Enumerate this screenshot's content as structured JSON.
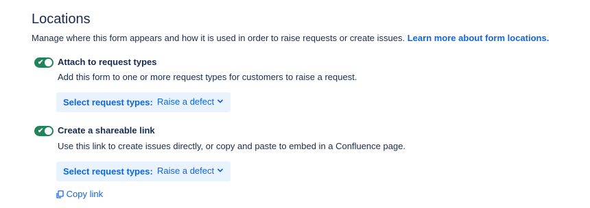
{
  "section": {
    "title": "Locations",
    "description": "Manage where this form appears and how it is used in order to raise requests or create issues.",
    "learn_more_link": "Learn more about form locations."
  },
  "options": [
    {
      "label": "Attach to request types",
      "enabled": true,
      "description": "Add this form to one or more request types for customers to raise a request.",
      "select_label": "Select request types:",
      "select_value": "Raise a defect"
    },
    {
      "label": "Create a shareable link",
      "enabled": true,
      "description": "Use this link to create issues directly, or copy and paste to embed in a Confluence page.",
      "select_label": "Select request types:",
      "select_value": "Raise a defect"
    }
  ],
  "copy_link": {
    "label": "Copy link",
    "icon": "copy-icon"
  },
  "colors": {
    "toggle_on": "#1f845a",
    "link": "#0c66e4",
    "select_bg": "#e9f2ff",
    "text": "#172b4d"
  }
}
